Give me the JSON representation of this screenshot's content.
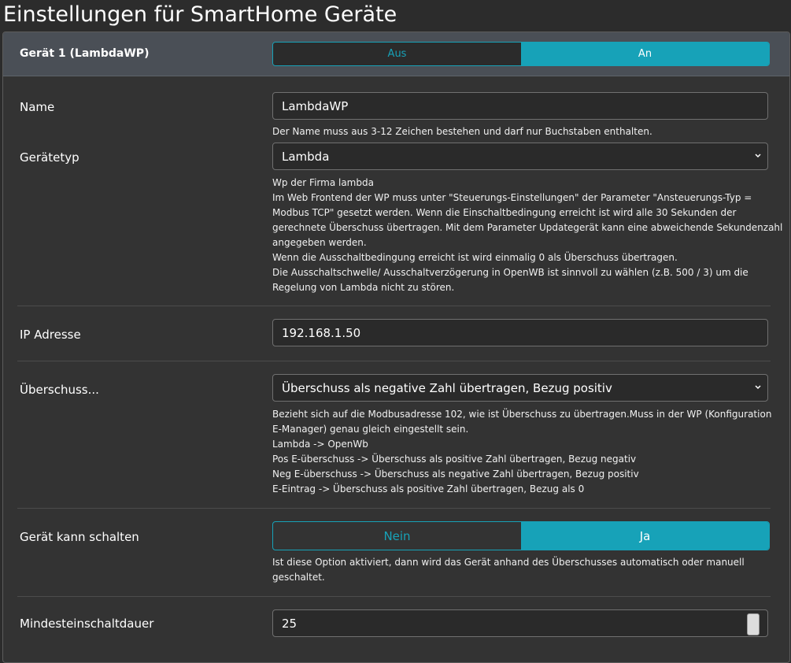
{
  "page_title": "Einstellungen für SmartHome Geräte",
  "device": {
    "title": "Gerät 1 (LambdaWP)",
    "toggle_off": "Aus",
    "toggle_on": "An"
  },
  "fields": {
    "name": {
      "label": "Name",
      "value": "LambdaWP",
      "help": "Der Name muss aus 3-12 Zeichen bestehen und darf nur Buchstaben enthalten."
    },
    "device_type": {
      "label": "Gerätetyp",
      "value": "Lambda",
      "help": [
        "Wp der Firma lambda",
        "Im Web Frontend der WP muss unter \"Steuerungs-Einstellungen\" der Parameter \"Ansteuerungs-Typ =",
        "Modbus TCP\" gesetzt werden. Wenn die Einschaltbedingung erreicht ist wird alle 30 Sekunden der",
        "gerechnete Überschuss übertragen. Mit dem Parameter Updategerät kann eine abweichende Sekundenzahl",
        "angegeben werden.",
        "Wenn die Ausschaltbedingung erreicht ist wird einmalig 0 als Überschuss übertragen.",
        "Die Ausschaltschwelle/ Ausschaltverzögerung in OpenWB ist sinnvoll zu wählen (z.B. 500 / 3) um die",
        "Regelung von Lambda nicht zu stören."
      ]
    },
    "ip": {
      "label": "IP Adresse",
      "value": "192.168.1.50"
    },
    "surplus": {
      "label": "Überschuss...",
      "value": "Überschuss als negative Zahl übertragen, Bezug positiv",
      "help": [
        "Bezieht sich auf die Modbusadresse 102, wie ist Überschuss zu übertragen.Muss in der WP (Konfiguration",
        "E-Manager) genau gleich eingestellt sein.",
        "Lambda -> OpenWb",
        "Pos E-überschuss -> Überschuss als positive Zahl übertragen, Bezug negativ",
        "Neg E-überschuss -> Überschuss als negative Zahl übertragen, Bezug positiv",
        "E-Eintrag -> Überschuss als positive Zahl übertragen, Bezug als 0"
      ]
    },
    "can_switch": {
      "label": "Gerät kann schalten",
      "off": "Nein",
      "on": "Ja",
      "help": [
        "Ist diese Option aktiviert, dann wird das Gerät anhand des Überschusses automatisch oder manuell",
        "geschaltet."
      ]
    },
    "min_on": {
      "label": "Mindesteinschaltdauer",
      "value": "25"
    }
  },
  "colors": {
    "accent": "#17a2b8",
    "background": "#2c2c2c",
    "card": "#333333",
    "header": "#4a4f56"
  }
}
